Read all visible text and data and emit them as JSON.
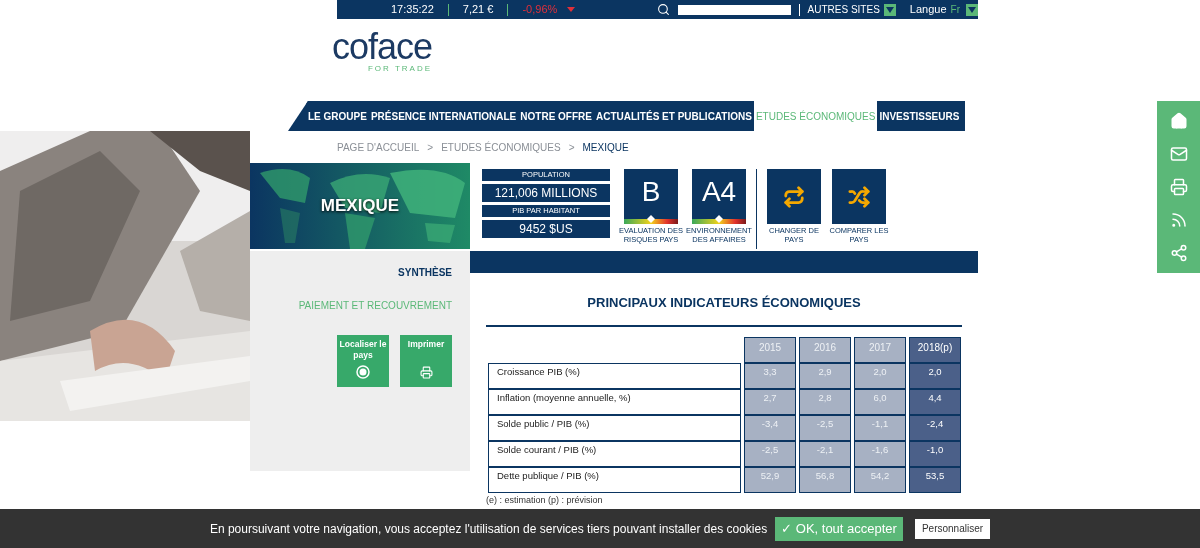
{
  "top_bar": {
    "time": "17:35:22",
    "price": "7,21 €",
    "change": "-0,96%",
    "links": [
      {
        "label": "AUTRES SITES"
      },
      {
        "label": "Langue",
        "value": "Fr"
      }
    ]
  },
  "logo": {
    "name": "coface",
    "tagline": "FOR TRADE"
  },
  "nav": [
    {
      "label": "LE GROUPE",
      "selected": false
    },
    {
      "label": "PRÉSENCE INTERNATIONALE",
      "selected": false
    },
    {
      "label": "NOTRE OFFRE",
      "selected": false
    },
    {
      "label": "ACTUALITÉS ET PUBLICATIONS",
      "selected": false
    },
    {
      "label": "ETUDES ÉCONOMIQUES",
      "selected": true
    },
    {
      "label": "INVESTISSEURS",
      "selected": false
    }
  ],
  "breadcrumb": [
    {
      "kind": "link",
      "label": "PAGE D'ACCUEIL"
    },
    {
      "kind": "separator",
      "label": ">"
    },
    {
      "kind": "link",
      "label": "ETUDES ÉCONOMIQUES"
    },
    {
      "kind": "separator",
      "label": ">"
    },
    {
      "kind": "current",
      "label": "MEXIQUE"
    }
  ],
  "country": "MEXIQUE",
  "side_menu": [
    {
      "label": "SYNTHÈSE",
      "selected": true
    },
    {
      "label": "PAIEMENT ET RECOUVREMENT",
      "selected": false
    }
  ],
  "side_buttons": [
    {
      "kind": "locate",
      "label": "Localiser le pays"
    },
    {
      "kind": "print",
      "label": "Imprimer"
    }
  ],
  "stats": [
    {
      "label": "POPULATION",
      "value": "121,006 MILLIONS"
    },
    {
      "label": "PIB PAR HABITANT",
      "value": "9452 $US"
    }
  ],
  "ratings": [
    {
      "grade": "B",
      "caption": "EVALUATION DES RISQUES PAYS"
    },
    {
      "grade": "A4",
      "caption": "ENVIRONNEMENT DES AFFAIRES"
    }
  ],
  "actions": [
    {
      "kind": "change",
      "caption": "CHANGER DE PAYS"
    },
    {
      "kind": "compare",
      "caption": "COMPARER LES PAYS"
    }
  ],
  "table": {
    "title": "PRINCIPAUX INDICATEURS ÉCONOMIQUES",
    "columns": [
      {
        "label": "2015",
        "kind": "actual"
      },
      {
        "label": "2016",
        "kind": "actual"
      },
      {
        "label": "2017",
        "kind": "actual"
      },
      {
        "label": "2018(p)",
        "kind": "forecast"
      }
    ],
    "rows": [
      {
        "label": "Croissance PIB (%)",
        "values": [
          "3,3",
          "2,9",
          "2,0",
          "2,0"
        ]
      },
      {
        "label": "Inflation (moyenne annuelle, %)",
        "values": [
          "2,7",
          "2,8",
          "6,0",
          "4,4"
        ]
      },
      {
        "label": "Solde public / PIB (%)",
        "values": [
          "-3,4",
          "-2,5",
          "-1,1",
          "-2,4"
        ]
      },
      {
        "label": "Solde courant / PIB (%)",
        "values": [
          "-2,5",
          "-2,1",
          "-1,6",
          "-1,0"
        ]
      },
      {
        "label": "Dette publique / PIB (%)",
        "values": [
          "52,9",
          "56,8",
          "54,2",
          "53,5"
        ]
      }
    ],
    "note": "(e) : estimation (p) : prévision"
  },
  "floating_bar": [
    {
      "kind": "home"
    },
    {
      "kind": "mail"
    },
    {
      "kind": "print"
    },
    {
      "kind": "rss"
    },
    {
      "kind": "share"
    }
  ],
  "cookie_bar": {
    "text": "En poursuivant votre navigation, vous acceptez l'utilisation de services tiers pouvant installer des cookies",
    "accept": "✓ OK, tout accepter",
    "customize": "Personnaliser"
  }
}
